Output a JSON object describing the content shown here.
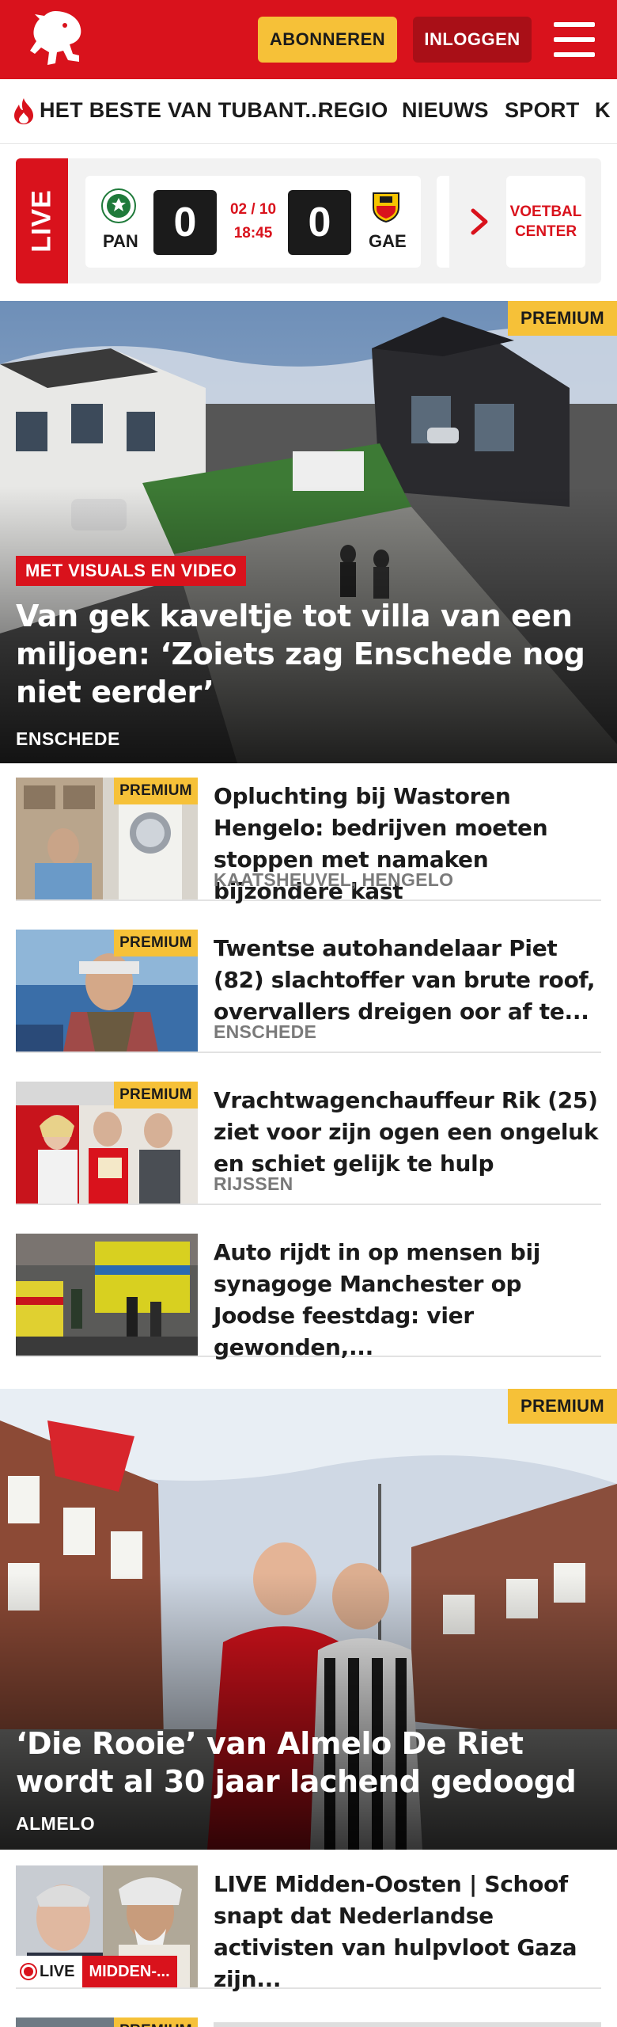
{
  "header": {
    "subscribe_label": "ABONNEREN",
    "login_label": "INLOGGEN",
    "brand_color": "#d9121c",
    "accent_color": "#f6c138"
  },
  "nav": {
    "items": [
      {
        "label": "HET BESTE VAN TUBANT..."
      },
      {
        "label": "REGIO"
      },
      {
        "label": "NIEUWS"
      },
      {
        "label": "SPORT"
      },
      {
        "label": "K"
      }
    ]
  },
  "live_bar": {
    "live_label": "LIVE",
    "match": {
      "home_code": "PAN",
      "away_code": "GAE",
      "home_score": "0",
      "away_score": "0",
      "date": "02 / 10",
      "time": "18:45"
    },
    "voetbal_center_label": "VOETBAL CENTER"
  },
  "hero1": {
    "premium_label": "PREMIUM",
    "label": "MET VISUALS EN VIDEO",
    "title": "Van gek kaveltje tot villa van een miljoen: ‘Zoiets zag Enschede nog niet eerder’",
    "location": "ENSCHEDE"
  },
  "articles": [
    {
      "premium_label": "PREMIUM",
      "title": "Opluchting bij Wastoren Hengelo: bedrijven moeten stoppen met namaken bijzondere kast",
      "location": "KAATSHEUVEL, HENGELO"
    },
    {
      "premium_label": "PREMIUM",
      "title": "Twentse autohandelaar Piet (82) slachtoffer van brute roof, overvallers dreigen oor af te...",
      "location": "ENSCHEDE"
    },
    {
      "premium_label": "PREMIUM",
      "title": "Vrachtwagenchauffeur Rik (25) ziet voor zijn ogen een ongeluk en schiet gelijk te hulp",
      "location": "RIJSSEN"
    },
    {
      "title": "Auto rijdt in op mensen bij synagoge Manchester op Joodse feestdag: vier gewonden,..."
    }
  ],
  "hero2": {
    "premium_label": "PREMIUM",
    "title": "‘Die Rooie’ van Almelo De Riet wordt al 30 jaar lachend gedoogd",
    "location": "ALMELO"
  },
  "live_article": {
    "title": "LIVE Midden-Oosten | Schoof snapt dat Nederlandse activisten van hulpvloot Gaza zijn...",
    "live_label": "LIVE",
    "tag_label": "MIDDEN-..."
  },
  "last_article": {
    "premium_label": "PREMIUM"
  }
}
